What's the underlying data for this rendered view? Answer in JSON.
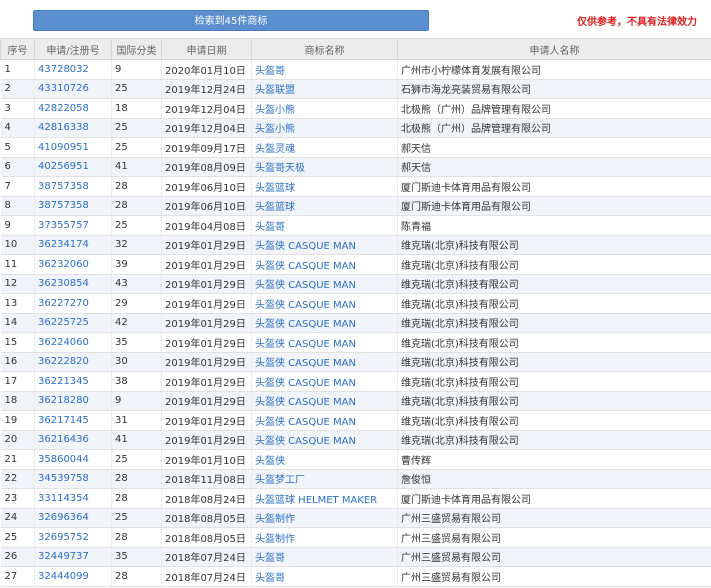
{
  "header": {
    "search_result_label": "检索到45件商标",
    "disclaimer": "仅供参考，不具有法律效力"
  },
  "table": {
    "columns": [
      "序号",
      "申请/注册号",
      "国际分类",
      "申请日期",
      "商标名称",
      "申请人名称"
    ],
    "rows": [
      {
        "no": "1",
        "reg": "43728032",
        "cls": "9",
        "date": "2020年01月10日",
        "name": "头盔哥",
        "applicant": "广州市小柠檬体育发展有限公司"
      },
      {
        "no": "2",
        "reg": "43310726",
        "cls": "25",
        "date": "2019年12月24日",
        "name": "头盔联盟",
        "applicant": "石狮市海龙亮装贸易有限公司"
      },
      {
        "no": "3",
        "reg": "42822058",
        "cls": "18",
        "date": "2019年12月04日",
        "name": "头盔小熊",
        "applicant": "北极熊（广州）品牌管理有限公司"
      },
      {
        "no": "4",
        "reg": "42816338",
        "cls": "25",
        "date": "2019年12月04日",
        "name": "头盔小熊",
        "applicant": "北极熊（广州）品牌管理有限公司"
      },
      {
        "no": "5",
        "reg": "41090951",
        "cls": "25",
        "date": "2019年09月17日",
        "name": "头盔灵魂",
        "applicant": "郝天信"
      },
      {
        "no": "6",
        "reg": "40256951",
        "cls": "41",
        "date": "2019年08月09日",
        "name": "头盔哥天极",
        "applicant": "郝天信"
      },
      {
        "no": "7",
        "reg": "38757358",
        "cls": "28",
        "date": "2019年06月10日",
        "name": "头盔篮球",
        "applicant": "厦门斯迪卡体育用品有限公司"
      },
      {
        "no": "8",
        "reg": "38757358",
        "cls": "28",
        "date": "2019年06月10日",
        "name": "头盔篮球",
        "applicant": "厦门斯迪卡体育用品有限公司"
      },
      {
        "no": "9",
        "reg": "37355757",
        "cls": "25",
        "date": "2019年04月08日",
        "name": "头盔哥",
        "applicant": "陈青福"
      },
      {
        "no": "10",
        "reg": "36234174",
        "cls": "32",
        "date": "2019年01月29日",
        "name": "头盔侠 CASQUE MAN",
        "applicant": "维克瑞(北京)科技有限公司"
      },
      {
        "no": "11",
        "reg": "36232060",
        "cls": "39",
        "date": "2019年01月29日",
        "name": "头盔侠 CASQUE MAN",
        "applicant": "维克瑞(北京)科技有限公司"
      },
      {
        "no": "12",
        "reg": "36230854",
        "cls": "43",
        "date": "2019年01月29日",
        "name": "头盔侠 CASQUE MAN",
        "applicant": "维克瑞(北京)科技有限公司"
      },
      {
        "no": "13",
        "reg": "36227270",
        "cls": "29",
        "date": "2019年01月29日",
        "name": "头盔侠 CASQUE MAN",
        "applicant": "维克瑞(北京)科技有限公司"
      },
      {
        "no": "14",
        "reg": "36225725",
        "cls": "42",
        "date": "2019年01月29日",
        "name": "头盔侠 CASQUE MAN",
        "applicant": "维克瑞(北京)科技有限公司"
      },
      {
        "no": "15",
        "reg": "36224060",
        "cls": "35",
        "date": "2019年01月29日",
        "name": "头盔侠 CASQUE MAN",
        "applicant": "维克瑞(北京)科技有限公司"
      },
      {
        "no": "16",
        "reg": "36222820",
        "cls": "30",
        "date": "2019年01月29日",
        "name": "头盔侠 CASQUE MAN",
        "applicant": "维克瑞(北京)科技有限公司"
      },
      {
        "no": "17",
        "reg": "36221345",
        "cls": "38",
        "date": "2019年01月29日",
        "name": "头盔侠 CASQUE MAN",
        "applicant": "维克瑞(北京)科技有限公司"
      },
      {
        "no": "18",
        "reg": "36218280",
        "cls": "9",
        "date": "2019年01月29日",
        "name": "头盔侠 CASQUE MAN",
        "applicant": "维克瑞(北京)科技有限公司"
      },
      {
        "no": "19",
        "reg": "36217145",
        "cls": "31",
        "date": "2019年01月29日",
        "name": "头盔侠 CASQUE MAN",
        "applicant": "维克瑞(北京)科技有限公司"
      },
      {
        "no": "20",
        "reg": "36216436",
        "cls": "41",
        "date": "2019年01月29日",
        "name": "头盔侠 CASQUE MAN",
        "applicant": "维克瑞(北京)科技有限公司"
      },
      {
        "no": "21",
        "reg": "35860044",
        "cls": "25",
        "date": "2019年01月10日",
        "name": "头盔侠",
        "applicant": "曹传辉"
      },
      {
        "no": "22",
        "reg": "34539758",
        "cls": "28",
        "date": "2018年11月08日",
        "name": "头盔梦工厂",
        "applicant": "詹俊恒"
      },
      {
        "no": "23",
        "reg": "33114354",
        "cls": "28",
        "date": "2018年08月24日",
        "name": "头盔篮球 HELMET MAKER",
        "applicant": "厦门斯迪卡体育用品有限公司"
      },
      {
        "no": "24",
        "reg": "32696364",
        "cls": "25",
        "date": "2018年08月05日",
        "name": "头盔制作",
        "applicant": "广州三盛贸易有限公司"
      },
      {
        "no": "25",
        "reg": "32695752",
        "cls": "28",
        "date": "2018年08月05日",
        "name": "头盔制作",
        "applicant": "广州三盛贸易有限公司"
      },
      {
        "no": "26",
        "reg": "32449737",
        "cls": "35",
        "date": "2018年07月24日",
        "name": "头盔哥",
        "applicant": "广州三盛贸易有限公司"
      },
      {
        "no": "27",
        "reg": "32444099",
        "cls": "28",
        "date": "2018年07月24日",
        "name": "头盔哥",
        "applicant": "广州三盛贸易有限公司"
      }
    ]
  }
}
